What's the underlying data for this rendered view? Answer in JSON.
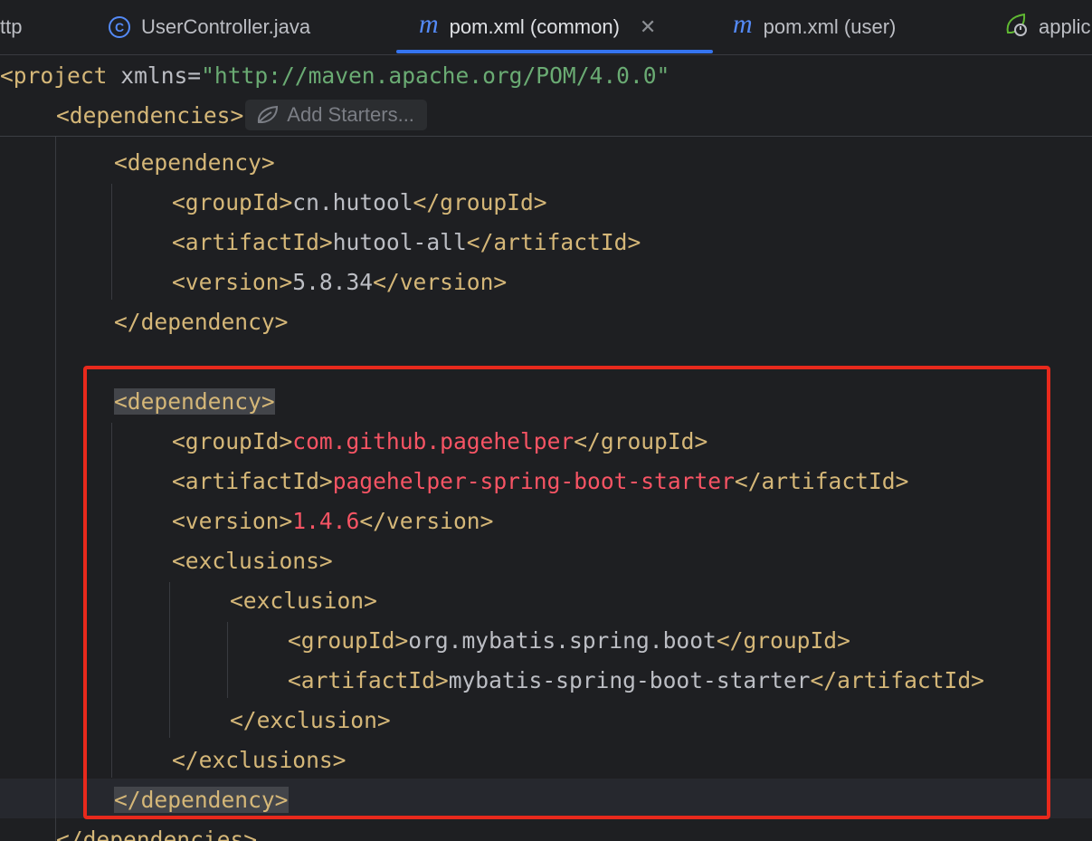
{
  "tabs": [
    {
      "label": "ttp",
      "icon": "none",
      "active": false
    },
    {
      "label": "UserController.java",
      "icon": "java-class-icon",
      "active": false
    },
    {
      "label": "pom.xml (common)",
      "icon": "maven-icon",
      "active": true,
      "close": "✕"
    },
    {
      "label": "pom.xml (user)",
      "icon": "maven-icon",
      "active": false
    },
    {
      "label": "applic",
      "icon": "spring-boot-icon",
      "active": false
    }
  ],
  "sticky_header": {
    "project_open": "<project",
    "project_attr": " xmlns=",
    "project_value": "\"http://maven.apache.org/POM/4.0.0\"",
    "dependencies_open": "<dependencies>",
    "add_starters_label": "Add Starters..."
  },
  "code": {
    "dep1_open": "<dependency>",
    "dep1_group_open": "<groupId>",
    "dep1_group_value": "cn.hutool",
    "dep1_group_close": "</groupId>",
    "dep1_artifact_open": "<artifactId>",
    "dep1_artifact_value": "hutool-all",
    "dep1_artifact_close": "</artifactId>",
    "dep1_version_open": "<version>",
    "dep1_version_value": "5.8.34",
    "dep1_version_close": "</version>",
    "dep1_close": "</dependency>",
    "dep2_open": "<dependency>",
    "dep2_group_open": "<groupId>",
    "dep2_group_value": "com.github.pagehelper",
    "dep2_group_close": "</groupId>",
    "dep2_artifact_open": "<artifactId>",
    "dep2_artifact_value": "pagehelper-spring-boot-starter",
    "dep2_artifact_close": "</artifactId>",
    "dep2_version_open": "<version>",
    "dep2_version_value": "1.4.6",
    "dep2_version_close": "</version>",
    "exclusions_open": "<exclusions>",
    "exclusion_open": "<exclusion>",
    "ex_group_open": "<groupId>",
    "ex_group_value": "org.mybatis.spring.boot",
    "ex_group_close": "</groupId>",
    "ex_artifact_open": "<artifactId>",
    "ex_artifact_value": "mybatis-spring-boot-starter",
    "ex_artifact_close": "</artifactId>",
    "exclusion_close": "</exclusion>",
    "exclusions_close": "</exclusions>",
    "dep2_close": "</dependency>",
    "dependencies_close": "</dependencies>"
  },
  "colors": {
    "background": "#1e1f22",
    "tag": "#d5b778",
    "text": "#bcbec4",
    "string": "#6aab73",
    "highlight_value": "#f75464",
    "annotation_border": "#e8291c",
    "active_tab_underline": "#3574f0"
  }
}
